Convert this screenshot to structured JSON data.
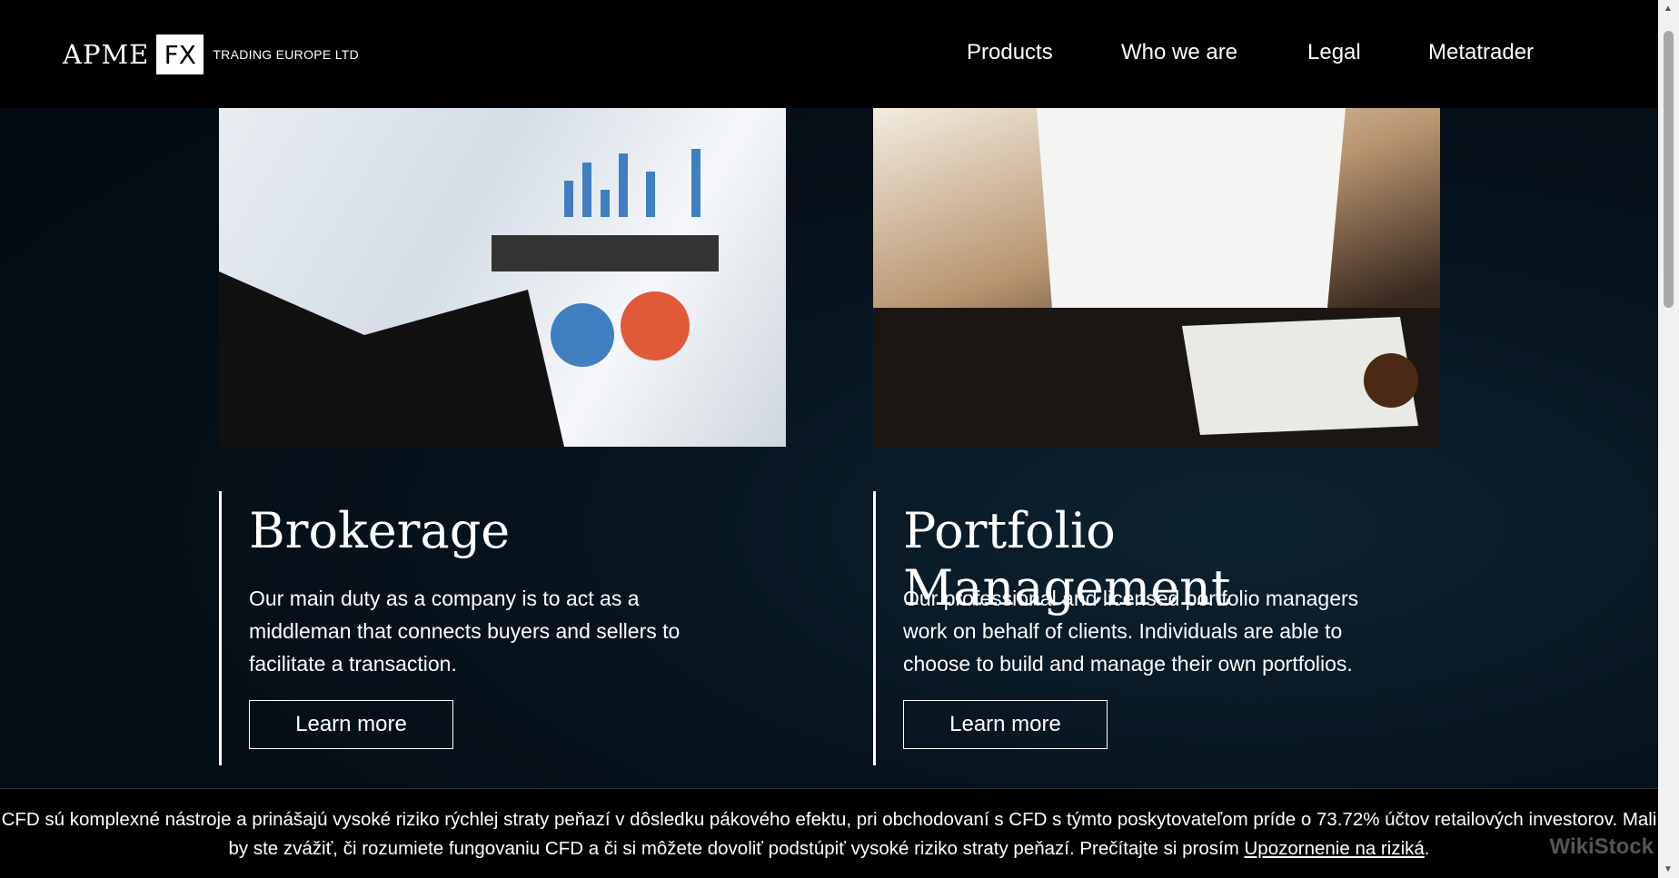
{
  "header": {
    "logo": {
      "apme": "APME",
      "fx": "FX",
      "subtitle": "TRADING EUROPE LTD"
    },
    "nav": [
      {
        "label": "Products"
      },
      {
        "label": "Who we are"
      },
      {
        "label": "Legal"
      },
      {
        "label": "Metatrader"
      }
    ]
  },
  "cards": [
    {
      "title": "Brokerage",
      "text": "Our main duty as a company is to act as a middleman that connects buyers and sellers to facilitate a transaction.",
      "button": "Learn more",
      "image": "business-report-chart-photo"
    },
    {
      "title": "Portfolio Management",
      "text": "Our professional and licensed portfolio managers work on behalf of clients. Individuals are able to choose to build and manage their own portfolios.",
      "button": "Learn more",
      "image": "businessman-at-desk-photo"
    }
  ],
  "footer": {
    "text": "CFD sú komplexné nástroje a prinášajú vysoké riziko rýchlej straty peňazí v dôsledku pákového efektu, pri obchodovaní s CFD s týmto poskytovateľom príde o 73.72% účtov retailových investorov. Mali by ste zvážiť, či rozumiete fungovaniu CFD a či si môžete dovoliť podstúpiť vysoké riziko straty peňazí. Prečítajte si prosím ",
    "link": "Upozornenie na riziká",
    "end": "."
  },
  "watermark": "WikiStock"
}
